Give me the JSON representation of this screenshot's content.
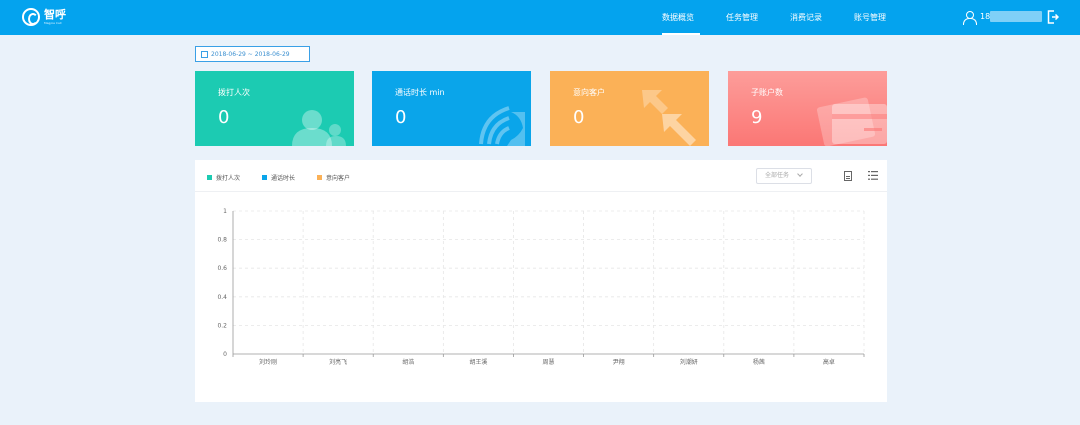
{
  "brand": {
    "name": "智呼",
    "subtitle": "Magpie Call"
  },
  "nav": {
    "items": [
      {
        "label": "数据概览",
        "active": true
      },
      {
        "label": "任务管理",
        "active": false
      },
      {
        "label": "消费记录",
        "active": false
      },
      {
        "label": "账号管理",
        "active": false
      }
    ]
  },
  "user": {
    "phone_prefix": "18"
  },
  "date_range": {
    "value": "2018-06-29 ~ 2018-06-29"
  },
  "cards": [
    {
      "title": "拨打人次",
      "value": "0",
      "icon": "users-icon",
      "color": "#1ccbb2"
    },
    {
      "title": "通话时长 min",
      "value": "0",
      "icon": "phone-icon",
      "color": "#0aa5ea"
    },
    {
      "title": "意向客户",
      "value": "0",
      "icon": "arrow-icon",
      "color": "#fbb157"
    },
    {
      "title": "子账户数",
      "value": "9",
      "icon": "card-icon",
      "color": "#fb7775"
    }
  ],
  "legend": [
    {
      "label": "拨打人次",
      "color": "#1ccbb2"
    },
    {
      "label": "通话时长",
      "color": "#0aa5ea"
    },
    {
      "label": "意向客户",
      "color": "#fbb157"
    }
  ],
  "task_filter": {
    "selected": "全部任务"
  },
  "chart_data": {
    "type": "bar",
    "categories": [
      "刘玲刚",
      "刘亮飞",
      "胡浩",
      "胡王溪",
      "周慧",
      "尹翔",
      "刘潮妍",
      "杨茜",
      "高卓"
    ],
    "series": [
      {
        "name": "拨打人次",
        "color": "#1ccbb2",
        "values": [
          0,
          0,
          0,
          0,
          0,
          0,
          0,
          0,
          0
        ]
      },
      {
        "name": "通话时长",
        "color": "#0aa5ea",
        "values": [
          0,
          0,
          0,
          0,
          0,
          0,
          0,
          0,
          0
        ]
      },
      {
        "name": "意向客户",
        "color": "#fbb157",
        "values": [
          0,
          0,
          0,
          0,
          0,
          0,
          0,
          0,
          0
        ]
      }
    ],
    "yticks": [
      "0",
      "0.2",
      "0.4",
      "0.6",
      "0.8",
      "1"
    ],
    "ylim": [
      0,
      1
    ],
    "grid": true
  }
}
